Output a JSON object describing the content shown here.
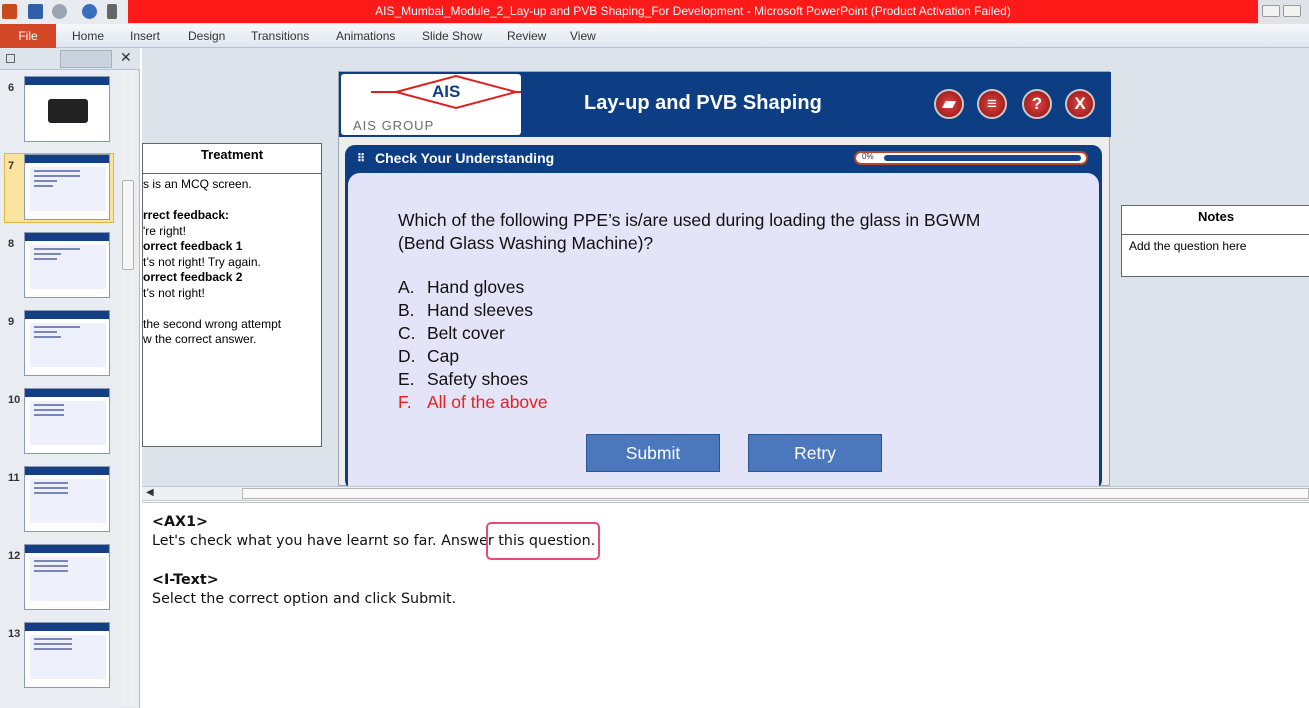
{
  "window": {
    "title": "AIS_Mumbai_Module_2_Lay-up and PVB Shaping_For Development  -  Microsoft PowerPoint (Product Activation Failed)"
  },
  "ribbon": {
    "file": "File",
    "tabs": [
      "Home",
      "Insert",
      "Design",
      "Transitions",
      "Animations",
      "Slide Show",
      "Review",
      "View"
    ]
  },
  "thumbnails": {
    "numbers": [
      "6",
      "7",
      "8",
      "9",
      "10",
      "11",
      "12",
      "13"
    ],
    "selected": "7"
  },
  "treatment": {
    "heading": "Treatment",
    "lines": [
      "s is an MCQ screen.",
      "",
      "rrect feedback:",
      "'re right!",
      "orrect feedback 1",
      "t’s not right! Try again.",
      "orrect feedback 2",
      "t’s not right!",
      "",
      "the second wrong attempt",
      "w the correct answer."
    ]
  },
  "notes_box": {
    "heading": "Notes",
    "body": "Add the question here"
  },
  "slide": {
    "logo_text": "AIS",
    "logo_sub": "AIS GROUP",
    "title": "Lay-up and PVB Shaping",
    "header_icons": [
      "folder-icon",
      "menu-icon",
      "help-icon",
      "exit-icon"
    ],
    "help_glyph": "?",
    "exit_glyph": "X",
    "panel_title": "Check Your Understanding",
    "progress_label": "0%",
    "progress": 0,
    "question": "Which of the following PPE’s is/are used during loading the glass in BGWM (Bend Glass Washing Machine)?",
    "options": [
      {
        "letter": "A.",
        "text": "Hand gloves"
      },
      {
        "letter": "B.",
        "text": "Hand sleeves"
      },
      {
        "letter": "C.",
        "text": "Belt cover"
      },
      {
        "letter": "D.",
        "text": "Cap"
      },
      {
        "letter": "E.",
        "text": "Safety shoes"
      },
      {
        "letter": "F.",
        "text": "All of the above"
      }
    ],
    "submit": "Submit",
    "retry": "Retry",
    "colors": {
      "header": "#0d3d83",
      "correct_option": "#e82020",
      "button": "#4b78bd"
    }
  },
  "notes_pane": {
    "tag1": "<AX1>",
    "line1": "Let's check what you have learnt so far. Answer this question.",
    "tag2": "<I-Text>",
    "line2": "Select the correct option and click Submit."
  }
}
